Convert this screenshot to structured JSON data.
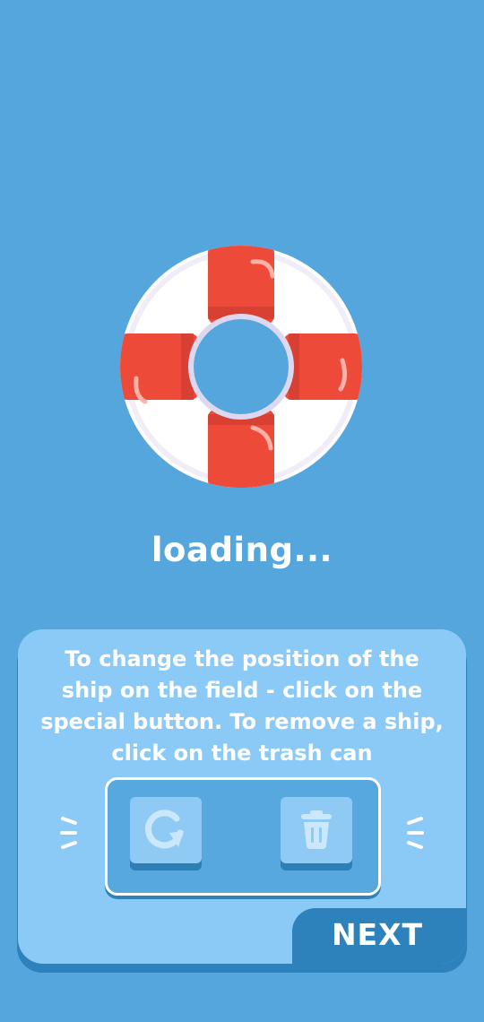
{
  "loading": {
    "label": "loading..."
  },
  "hint": {
    "line1": "To change the position of the",
    "line2": "ship on the field - click on the",
    "line3": "special button. To remove a ship,",
    "line4": "click on the trash can",
    "rotate_icon": "rotate-icon",
    "trash_icon": "trash-icon"
  },
  "actions": {
    "next_label": "NEXT"
  },
  "colors": {
    "background": "#55a6dc",
    "card": "#8bcaf6",
    "card_shadow": "#2d82bb",
    "panel": "#56a8df",
    "buoy_red": "#ee4a3a",
    "buoy_white": "#ffffff",
    "text": "#ffffff"
  }
}
